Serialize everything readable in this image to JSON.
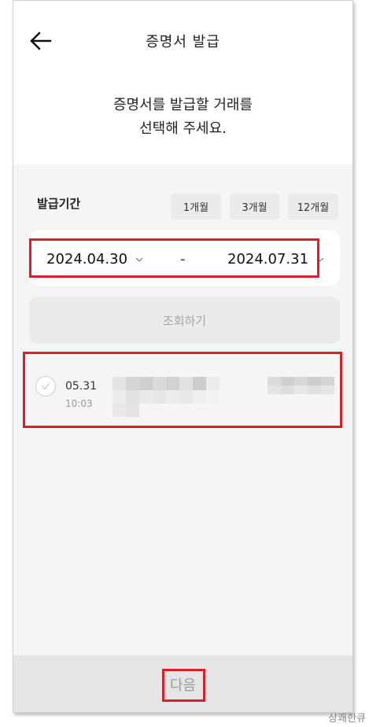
{
  "header": {
    "title": "증명서 발급",
    "back_icon": "arrow-left-icon",
    "subtitle_line1": "증명서를 발급할 거래를",
    "subtitle_line2": "선택해 주세요."
  },
  "period": {
    "label": "발급기간",
    "chips": [
      "1개월",
      "3개월",
      "12개월"
    ],
    "from_date": "2024.04.30",
    "to_date": "2024.07.31",
    "separator": "-",
    "dropdown_icon": "chevron-down-icon"
  },
  "search": {
    "label": "조회하기"
  },
  "transactions": [
    {
      "date": "05.31",
      "time": "10:03",
      "selected": false
    }
  ],
  "footer": {
    "next_label": "다음"
  },
  "watermark": "상쾌한큐",
  "colors": {
    "highlight": "#d9202a",
    "background": "#f5f5f5",
    "chip": "#ebebeb",
    "disabled_text": "#a5a5a5"
  }
}
